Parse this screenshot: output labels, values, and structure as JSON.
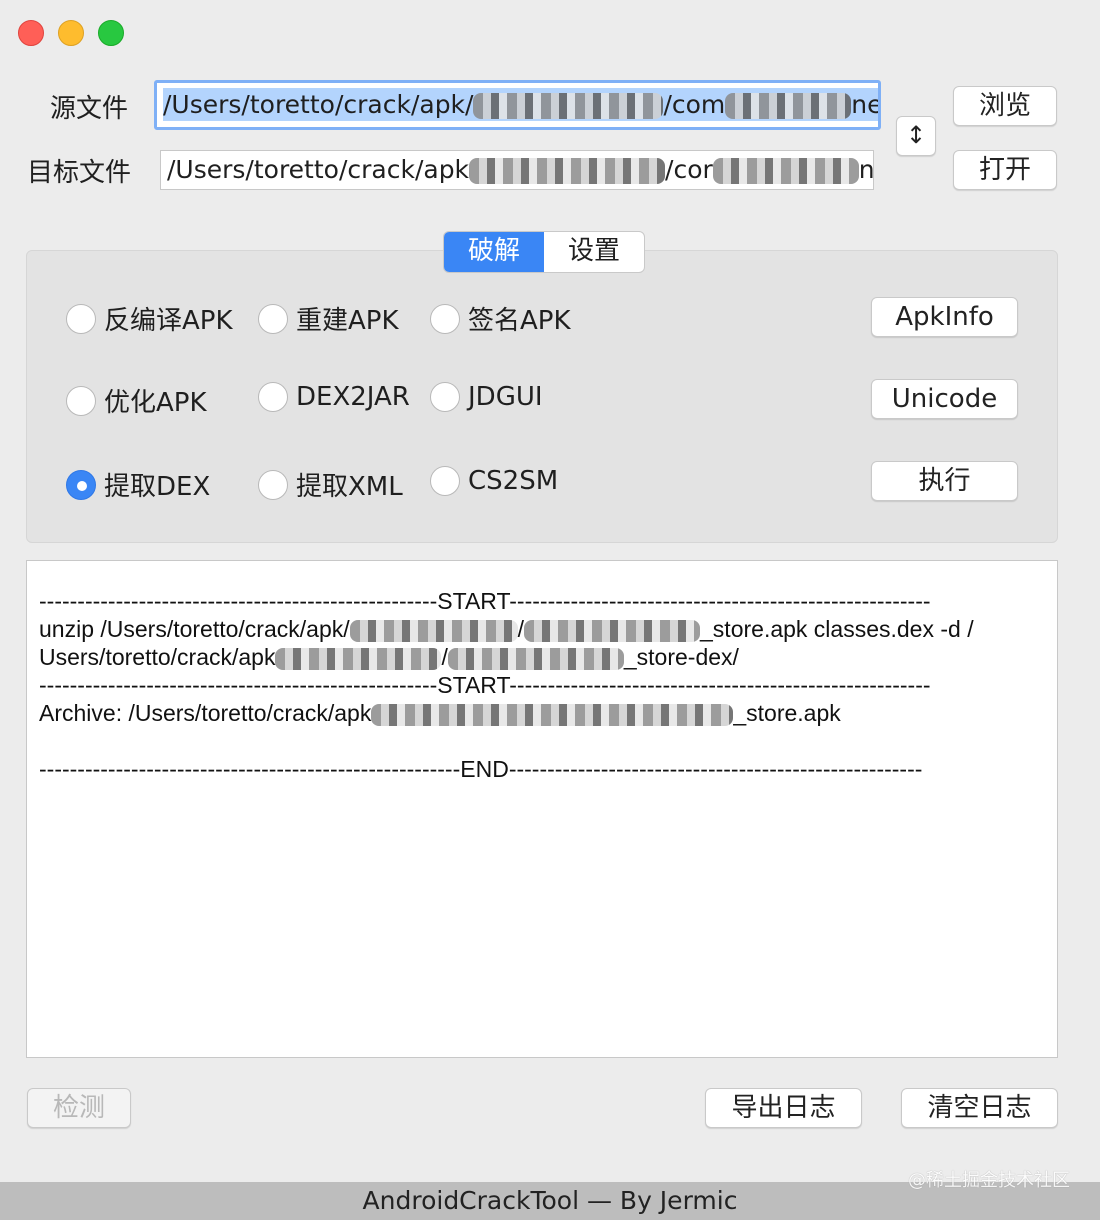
{
  "source": {
    "label": "源文件",
    "path_prefix": "/Users/toretto/crack/apk/",
    "path_mid": "/com",
    "path_end": "ne"
  },
  "target": {
    "label": "目标文件",
    "path_prefix": "/Users/toretto/crack/apk",
    "path_mid": "/cor",
    "path_end": "ne"
  },
  "swap_icon": "↕",
  "buttons": {
    "browse": "浏览",
    "open": "打开",
    "apkinfo": "ApkInfo",
    "unicode": "Unicode",
    "execute": "执行",
    "detect": "检测",
    "export_log": "导出日志",
    "clear_log": "清空日志"
  },
  "tabs": [
    {
      "label": "破解",
      "active": true
    },
    {
      "label": "设置",
      "active": false
    }
  ],
  "radios": [
    {
      "label": "反编译APK",
      "selected": false
    },
    {
      "label": "重建APK",
      "selected": false
    },
    {
      "label": "签名APK",
      "selected": false
    },
    {
      "label": "优化APK",
      "selected": false
    },
    {
      "label": "DEX2JAR",
      "selected": false
    },
    {
      "label": "JDGUI",
      "selected": false
    },
    {
      "label": "提取DEX",
      "selected": true
    },
    {
      "label": "提取XML",
      "selected": false
    },
    {
      "label": "CS2SM",
      "selected": false
    }
  ],
  "log": {
    "line1": "----------------------------------------------------START-------------------------------------------------------",
    "line2a": "unzip  /Users/toretto/crack/apk/",
    "line2b": "/",
    "line2c": "_store.apk classes.dex -d /",
    "line3a": "Users/toretto/crack/apk",
    "line3b": "/",
    "line3c": "_store-dex/",
    "line4": "----------------------------------------------------START-------------------------------------------------------",
    "line5a": "Archive:  /Users/toretto/crack/apk",
    "line5b": "_store.apk",
    "line7": "-------------------------------------------------------END------------------------------------------------------"
  },
  "footer": "AndroidCrackTool    —   By  Jermic",
  "watermark": "@稀土掘金技术社区",
  "colors": {
    "accent": "#3a86f5",
    "window_bg": "#ececec",
    "footer_bg": "#bdbdbd"
  }
}
